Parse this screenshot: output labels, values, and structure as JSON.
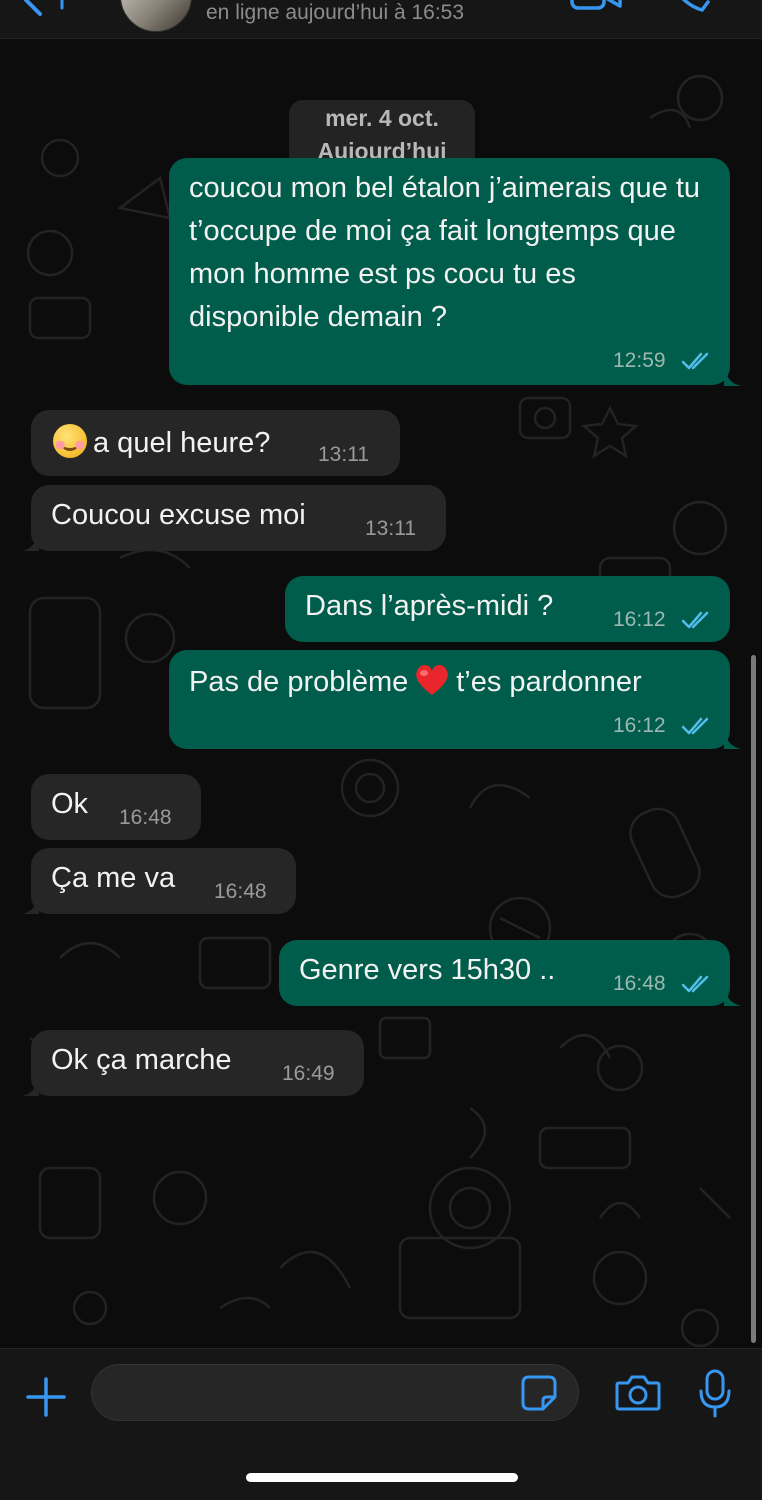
{
  "header": {
    "status_text": "en ligne aujourd’hui à 16:53"
  },
  "chat": {
    "date_pill": {
      "line1": "mer. 4 oct.",
      "line2": "Aujourd’hui"
    },
    "messages": [
      {
        "direction": "out",
        "text": "coucou mon bel étalon j’aimerais que tu t’occupe de moi ça fait longtemps que mon homme est ps cocu tu es disponible demain ?",
        "time": "12:59",
        "read": true
      },
      {
        "direction": "in",
        "emoji": "relieved-face-emoji",
        "text": "a quel heure?",
        "time": "13:11"
      },
      {
        "direction": "in",
        "text": "Coucou excuse moi",
        "time": "13:11"
      },
      {
        "direction": "out",
        "text": "Dans l’après-midi ?",
        "time": "16:12",
        "read": true
      },
      {
        "direction": "out",
        "text_before": "Pas de problème",
        "emoji": "red-heart-emoji",
        "text_after": "t’es pardonner",
        "time": "16:12",
        "read": true
      },
      {
        "direction": "in",
        "text": "Ok",
        "time": "16:48"
      },
      {
        "direction": "in",
        "text": "Ça me va",
        "time": "16:48"
      },
      {
        "direction": "out",
        "text": "Genre vers 15h30 ..",
        "time": "16:48",
        "read": true
      },
      {
        "direction": "in",
        "text": "Ok ça marche",
        "time": "16:49"
      }
    ]
  },
  "composer": {
    "input_value": "",
    "input_placeholder": ""
  },
  "colors": {
    "background": "#0c0c0c",
    "outgoing_bubble": "#005c4b",
    "incoming_bubble": "#262626",
    "read_ticks": "#53bdeb",
    "accent_blue": "#3797f0"
  }
}
